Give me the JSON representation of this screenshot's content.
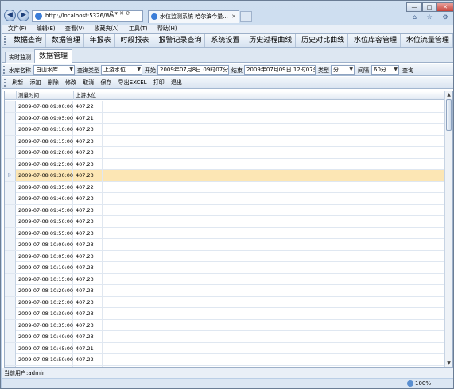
{
  "browser": {
    "address": "http://localhost:5326/Wa",
    "address_tools": "P ▾ ✕ ⟳",
    "tab_title": "水位监测系统 哈尔滨今量...",
    "tab_close": "✕",
    "back": "◀",
    "forward": "▶",
    "min": "—",
    "max": "□",
    "close": "✕",
    "right_icons": "⌂ ☆ ⚙",
    "zoom": "100%"
  },
  "menubar": [
    "文件(F)",
    "编辑(E)",
    "查看(V)",
    "收藏夹(A)",
    "工具(T)",
    "帮助(H)"
  ],
  "topnav": [
    "数据查询",
    "数据管理",
    "年报表",
    "时段报表",
    "报警记录查询",
    "系统设置",
    "历史过程曲线",
    "历史对比曲线",
    "水位库容管理",
    "水位流量管理"
  ],
  "tabs": {
    "realtime": "实时监测",
    "data_mgmt": "数据管理"
  },
  "filter": {
    "reservoir_label": "水库名称",
    "reservoir_value": "白山水库",
    "querytype_label": "查询类型",
    "querytype_value": "上游水位",
    "start_label": "开始",
    "start_value": "2009年07月8日 09时07分",
    "end_label": "结束",
    "end_value": "2009年07月09日 12时07分",
    "type_label": "类型",
    "type_value": "分",
    "interval_label": "间隔",
    "interval_value": "60分",
    "query_button": "查询"
  },
  "toolbar": [
    "刷新",
    "添加",
    "删除",
    "修改",
    "取消",
    "保存",
    "导出EXCEL",
    "打印",
    "退出"
  ],
  "grid": {
    "columns": [
      "测量时间",
      "上游水位"
    ],
    "selected_marker": "▷",
    "rows": [
      [
        "2009-07-08 09:00:00",
        "407.22"
      ],
      [
        "2009-07-08 09:05:00",
        "407.21"
      ],
      [
        "2009-07-08 09:10:00",
        "407.23"
      ],
      [
        "2009-07-08 09:15:00",
        "407.23"
      ],
      [
        "2009-07-08 09:20:00",
        "407.23"
      ],
      [
        "2009-07-08 09:25:00",
        "407.23"
      ],
      [
        "2009-07-08 09:30:00",
        "407.23"
      ],
      [
        "2009-07-08 09:35:00",
        "407.22"
      ],
      [
        "2009-07-08 09:40:00",
        "407.23"
      ],
      [
        "2009-07-08 09:45:00",
        "407.23"
      ],
      [
        "2009-07-08 09:50:00",
        "407.23"
      ],
      [
        "2009-07-08 09:55:00",
        "407.23"
      ],
      [
        "2009-07-08 10:00:00",
        "407.23"
      ],
      [
        "2009-07-08 10:05:00",
        "407.23"
      ],
      [
        "2009-07-08 10:10:00",
        "407.23"
      ],
      [
        "2009-07-08 10:15:00",
        "407.23"
      ],
      [
        "2009-07-08 10:20:00",
        "407.23"
      ],
      [
        "2009-07-08 10:25:00",
        "407.23"
      ],
      [
        "2009-07-08 10:30:00",
        "407.23"
      ],
      [
        "2009-07-08 10:35:00",
        "407.23"
      ],
      [
        "2009-07-08 10:40:00",
        "407.23"
      ],
      [
        "2009-07-08 10:45:00",
        "407.21"
      ],
      [
        "2009-07-08 10:50:00",
        "407.22"
      ],
      [
        "2009-07-08 10:55:00",
        "407.24"
      ]
    ],
    "selected_index": 6
  },
  "status": {
    "user_label": "当前用户:admin"
  }
}
